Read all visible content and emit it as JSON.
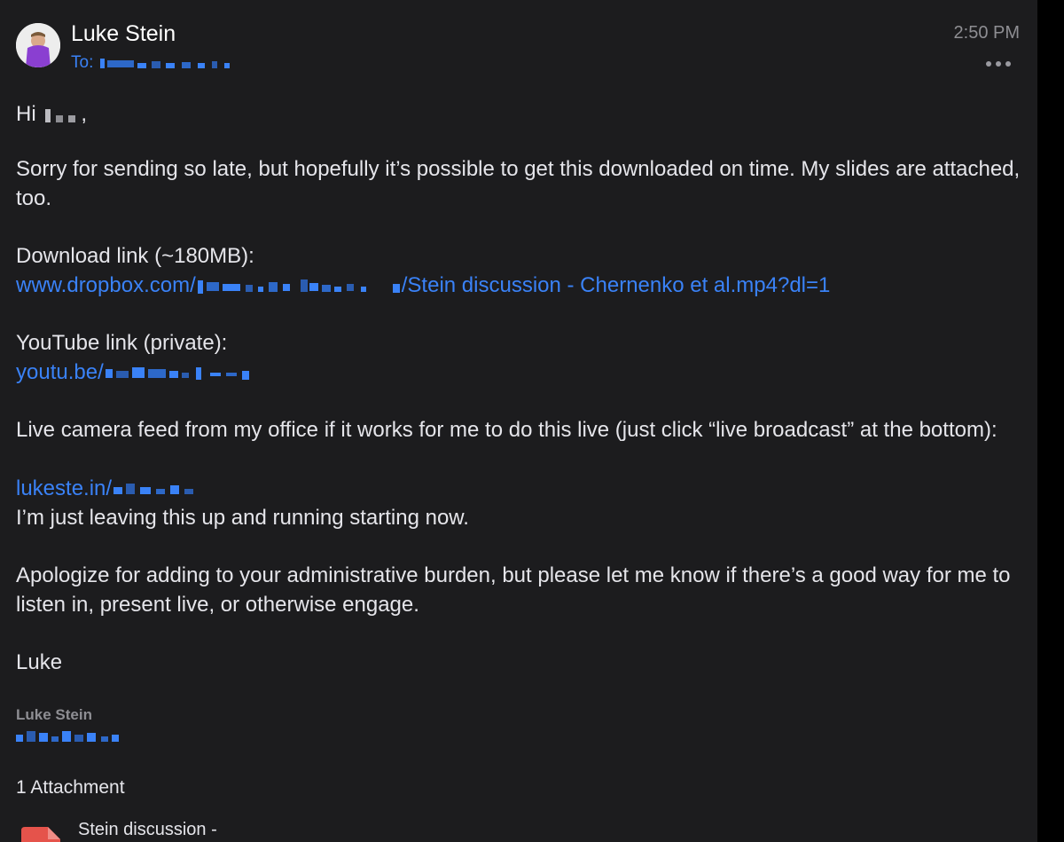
{
  "header": {
    "sender_name": "Luke Stein",
    "to_label": "To:",
    "time": "2:50 PM",
    "more_icon": "ellipsis-icon"
  },
  "body": {
    "greeting": "Hi",
    "greeting_punct": ",",
    "para1": "Sorry for sending so late, but hopefully it’s possible to get this downloaded on time. My slides are attached, too.",
    "download_label": "Download link (~180MB):",
    "dropbox_prefix": "www.dropbox.com/",
    "dropbox_suffix": "/Stein discussion - Chernenko et al.mp4?dl=1",
    "youtube_label": "YouTube link (private):",
    "youtube_prefix": "youtu.be/",
    "live_para": "Live camera feed from my office if it works for me to do this live (just click “live broadcast” at the bottom):",
    "live_link_prefix": "lukeste.in/",
    "live_note": "I’m just leaving this up and running starting now.",
    "para_apology": "Apologize for adding to your administrative burden, but please let me know if there’s a good way for me to listen in, present live, or otherwise engage.",
    "signoff": "Luke"
  },
  "signature": {
    "name": "Luke Stein"
  },
  "attachments": {
    "count_label": "1 Attachment",
    "file_name": "Stein discussion -",
    "file_icon": "pdf-file-icon"
  },
  "colors": {
    "background": "#1c1c1e",
    "link": "#3a82f7",
    "text": "#e5e5ea",
    "muted": "#8e8e93",
    "file_icon": "#e5534b"
  }
}
